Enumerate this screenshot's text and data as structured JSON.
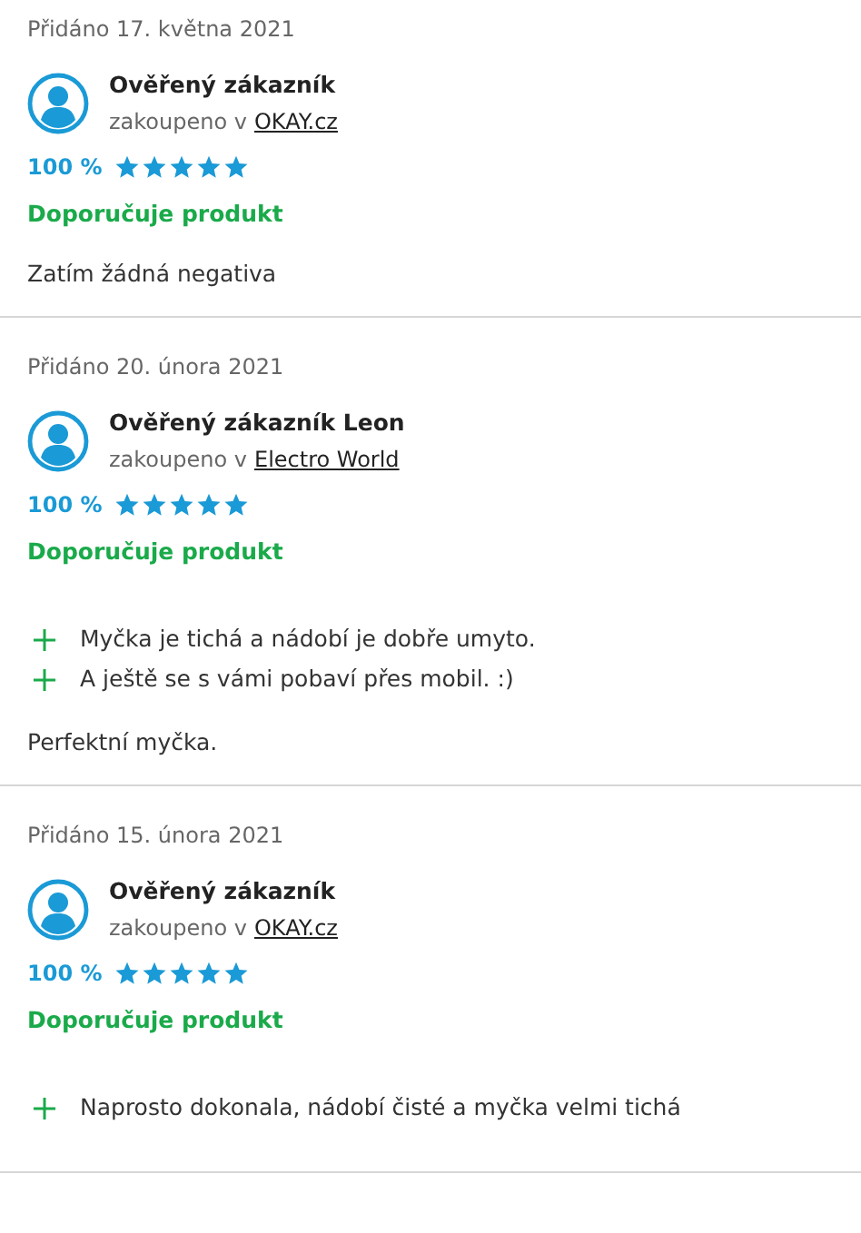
{
  "reviews": [
    {
      "date": "Přidáno 17. května 2021",
      "author": "Ověřený zákazník",
      "shop_prefix": "zakoupeno v",
      "shop": "OKAY.cz",
      "rating": "100 %",
      "stars": 5,
      "recommendation": "Doporučuje produkt",
      "blocks": [
        {
          "kind": "text",
          "text": "Zatím žádná negativa"
        }
      ]
    },
    {
      "date": "Přidáno 20. února 2021",
      "author": "Ověřený zákazník Leon",
      "shop_prefix": "zakoupeno v",
      "shop": "Electro World",
      "rating": "100 %",
      "stars": 5,
      "recommendation": "Doporučuje produkt",
      "blocks": [
        {
          "kind": "pros",
          "items": [
            "Myčka je tichá a nádobí je dobře umyto.",
            "A ještě se s vámi pobaví přes mobil. :)"
          ]
        },
        {
          "kind": "text",
          "text": "Perfektní myčka."
        }
      ]
    },
    {
      "date": "Přidáno 15. února 2021",
      "author": "Ověřený zákazník",
      "shop_prefix": "zakoupeno v",
      "shop": "OKAY.cz",
      "rating": "100 %",
      "stars": 5,
      "recommendation": "Doporučuje produkt",
      "blocks": [
        {
          "kind": "pros",
          "items": [
            "Naprosto dokonala, nádobí čisté a myčka velmi tichá"
          ]
        }
      ]
    }
  ]
}
